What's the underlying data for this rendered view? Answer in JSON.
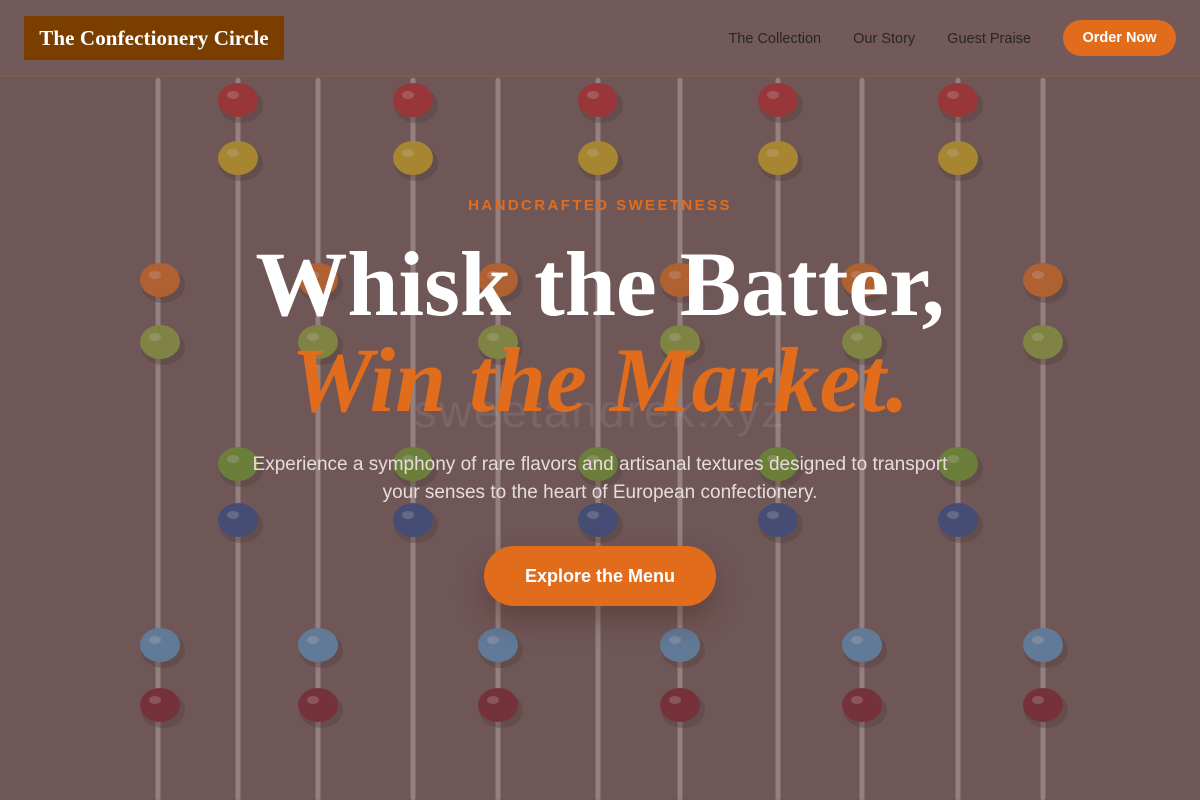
{
  "nav": {
    "brand": "The Confectionery Circle",
    "links": [
      "The Collection",
      "Our Story",
      "Guest Praise"
    ],
    "order_label": "Order Now"
  },
  "hero": {
    "eyebrow": "HANDCRAFTED SWEETNESS",
    "title_line1": "Whisk the Batter,",
    "title_line2": "Win the Market.",
    "lede": "Experience a symphony of rare flavors and artisanal textures designed to transport your senses to the heart of European confectionery.",
    "cta_label": "Explore the Menu",
    "background_watermark": "sweetandrek.xyz"
  },
  "colors": {
    "accent": "#e06c1c",
    "brand_bg": "#7a3e00",
    "overlay": "#725a5a",
    "text_light": "#ffffff",
    "nav_text": "#2a2424"
  },
  "background": {
    "image": "lollipop-grid-photo",
    "candy_colors": [
      "#b4242a",
      "#c9a51a",
      "#d86a1c",
      "#8aa03a",
      "#6a9a2a",
      "#2e4a8a",
      "#5a92c0",
      "#7a1e2a"
    ]
  }
}
